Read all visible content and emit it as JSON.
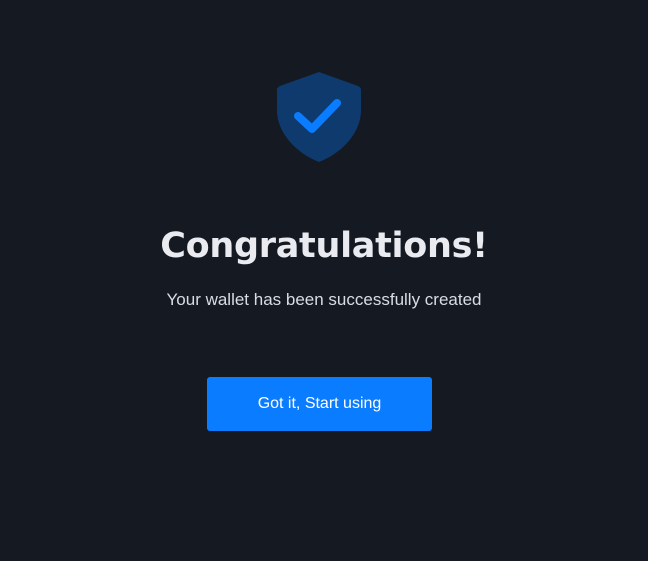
{
  "success": {
    "icon": "shield-check-icon",
    "title": "Congratulations!",
    "message": "Your wallet has been successfully created",
    "button_label": "Got it, Start using"
  },
  "colors": {
    "background": "#151a22",
    "shield": "#0f3a6e",
    "check": "#0a7cff",
    "button": "#0a7cff",
    "title_text": "#e9ebf0"
  }
}
